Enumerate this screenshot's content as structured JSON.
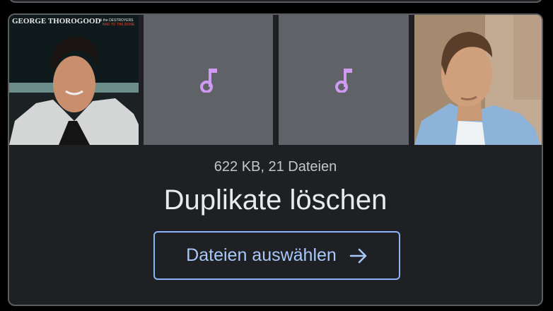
{
  "card": {
    "thumbnails": [
      {
        "kind": "image",
        "icon": "album-cover-image",
        "caption_left": "GEORGE THOROGOOD",
        "caption_right": "& the DESTROYERS",
        "caption_sub": "BAD TO THE BONE"
      },
      {
        "kind": "placeholder",
        "icon": "music-note-icon"
      },
      {
        "kind": "placeholder",
        "icon": "music-note-icon"
      },
      {
        "kind": "image",
        "icon": "portrait-image"
      }
    ],
    "summary": "622 KB, 21 Dateien",
    "title": "Duplikate löschen",
    "button_label": "Dateien auswählen",
    "button_icon": "arrow-right-icon"
  },
  "colors": {
    "card_bg": "#1f2023",
    "placeholder_bg": "#5f6368",
    "note": "#d09af4",
    "accent": "#8ab4f8"
  }
}
